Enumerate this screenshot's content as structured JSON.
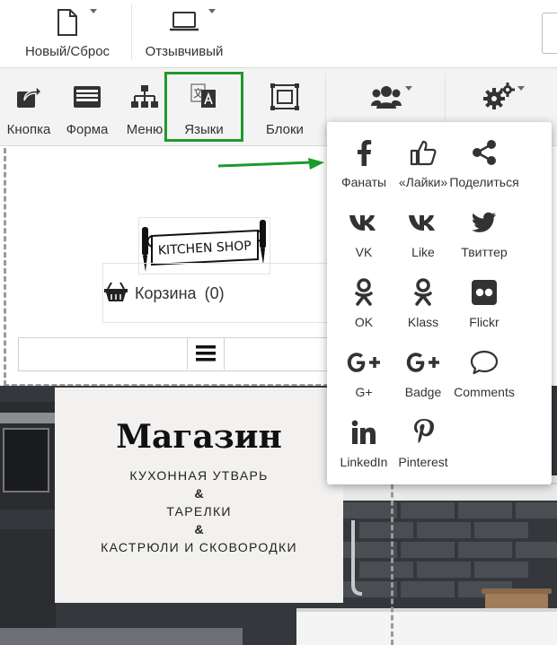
{
  "top_toolbar": {
    "new_reset_label": "Новый/Сброс",
    "responsive_label": "Отзывчивый"
  },
  "toolbar": {
    "button_label": "Кнопка",
    "form_label": "Форма",
    "menu_label": "Меню",
    "languages_label": "Языки",
    "blocks_label": "Блоки"
  },
  "canvas": {
    "logo_text": "KITCHEN SHOP",
    "cart_label": "Корзина",
    "cart_count": "(0)"
  },
  "hero": {
    "title": "Магазин",
    "line1": "КУХОННАЯ УТВАРЬ",
    "amp1": "&",
    "line2": "ТАРЕЛКИ",
    "amp2": "&",
    "line3": "КАСТРЮЛИ И СКОВОРОДКИ"
  },
  "social_menu": {
    "items": [
      {
        "label": "Фанаты",
        "icon": "facebook-icon"
      },
      {
        "label": "«Лайки»",
        "icon": "thumbs-up-icon"
      },
      {
        "label": "Поделиться",
        "icon": "share-icon"
      },
      {
        "label": "VK",
        "icon": "vk-icon"
      },
      {
        "label": "Like",
        "icon": "vk-like-icon"
      },
      {
        "label": "Твиттер",
        "icon": "twitter-icon"
      },
      {
        "label": "OK",
        "icon": "odnoklassniki-icon"
      },
      {
        "label": "Klass",
        "icon": "odnoklassniki-klass-icon"
      },
      {
        "label": "Flickr",
        "icon": "flickr-icon"
      },
      {
        "label": "G+",
        "icon": "google-plus-icon"
      },
      {
        "label": "Badge",
        "icon": "google-plus-badge-icon"
      },
      {
        "label": "Comments",
        "icon": "comment-icon"
      },
      {
        "label": "LinkedIn",
        "icon": "linkedin-icon"
      },
      {
        "label": "Pinterest",
        "icon": "pinterest-icon"
      }
    ]
  },
  "colors": {
    "highlight_green": "#1e9a2c",
    "icon_dark": "#333333",
    "toolbar_bg": "#f3f3f3"
  }
}
